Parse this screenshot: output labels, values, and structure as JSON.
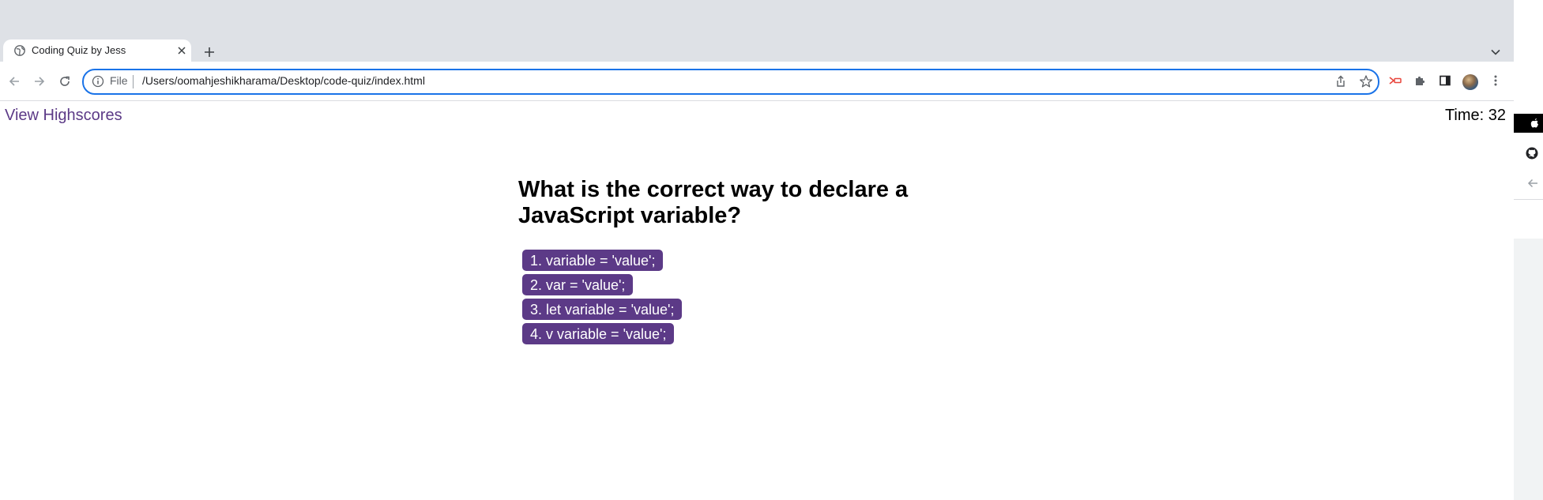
{
  "browser": {
    "tab_title": "Coding Quiz by Jess",
    "omnibox_scheme": "File",
    "url": "/Users/oomahjeshikharama/Desktop/code-quiz/index.html"
  },
  "page": {
    "highscores_link": "View Highscores",
    "timer_text": "Time: 32",
    "question": "What is the correct way to declare a JavaScript variable?",
    "answers": [
      "1. variable = 'value';",
      "2. var = 'value';",
      "3. let variable = 'value';",
      "4. v variable = 'value';"
    ]
  },
  "colors": {
    "accent": "#5c3a87",
    "omnibox_focus": "#1a73e8",
    "tabstrip": "#dee1e6"
  },
  "icons": [
    "globe-icon",
    "close-icon",
    "plus-icon",
    "chevron-down-icon",
    "back-arrow-icon",
    "forward-arrow-icon",
    "reload-icon",
    "info-icon",
    "share-icon",
    "star-icon",
    "extension-icon",
    "puzzle-icon",
    "side-panel-icon",
    "more-icon",
    "apple-icon",
    "github-icon"
  ]
}
